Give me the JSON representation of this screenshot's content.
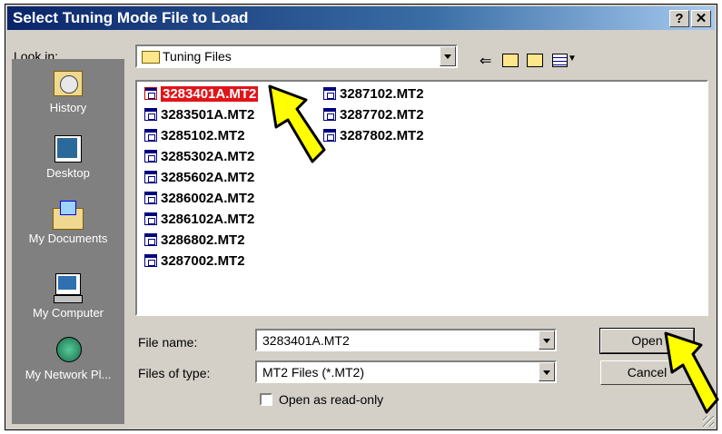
{
  "window": {
    "title": "Select Tuning Mode File to Load",
    "help_button": "?",
    "close_button": "✕"
  },
  "lookin": {
    "label": "Look in:",
    "value": "Tuning Files",
    "back_icon": "back-arrow-icon",
    "up_icon": "up-folder-icon",
    "newfolder_icon": "new-folder-icon",
    "view_icon": "view-menu-icon"
  },
  "places": [
    {
      "label": "History",
      "icon": "history-icon"
    },
    {
      "label": "Desktop",
      "icon": "desktop-icon"
    },
    {
      "label": "My Documents",
      "icon": "my-documents-icon"
    },
    {
      "label": "My Computer",
      "icon": "my-computer-icon"
    },
    {
      "label": "My Network Pl...",
      "icon": "network-places-icon"
    }
  ],
  "files": [
    {
      "name": "3283401A.MT2",
      "selected": true
    },
    {
      "name": "3283501A.MT2"
    },
    {
      "name": "3285102.MT2"
    },
    {
      "name": "3285302A.MT2"
    },
    {
      "name": "3285602A.MT2"
    },
    {
      "name": "3286002A.MT2"
    },
    {
      "name": "3286102A.MT2"
    },
    {
      "name": "3286802.MT2"
    },
    {
      "name": "3287002.MT2"
    },
    {
      "name": "3287102.MT2"
    },
    {
      "name": "3287702.MT2"
    },
    {
      "name": "3287802.MT2"
    }
  ],
  "filename": {
    "label": "File name:",
    "value": "3283401A.MT2"
  },
  "filetype": {
    "label": "Files of type:",
    "value": "MT2 Files (*.MT2)"
  },
  "readonly": {
    "label": "Open as read-only",
    "checked": false
  },
  "buttons": {
    "open": "Open",
    "cancel": "Cancel"
  },
  "colors": {
    "title_bar": "#0a246a",
    "selection": "#e0151a",
    "annotation_arrow": "#ffff00"
  }
}
